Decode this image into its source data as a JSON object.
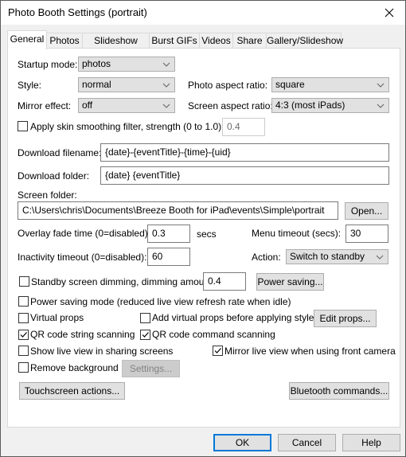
{
  "window": {
    "title": "Photo Booth Settings (portrait)",
    "close_icon": "close-icon"
  },
  "tabs": [
    {
      "label": "General",
      "active": true
    },
    {
      "label": "Photos",
      "active": false
    },
    {
      "label": "Slideshow GIFs",
      "active": false
    },
    {
      "label": "Burst GIFs",
      "active": false
    },
    {
      "label": "Videos",
      "active": false
    },
    {
      "label": "Share",
      "active": false
    },
    {
      "label": "Gallery/Slideshow",
      "active": false
    }
  ],
  "general": {
    "startup_mode": {
      "label": "Startup mode:",
      "value": "photos"
    },
    "style": {
      "label": "Style:",
      "value": "normal"
    },
    "mirror_effect": {
      "label": "Mirror effect:",
      "value": "off"
    },
    "photo_aspect_ratio": {
      "label": "Photo aspect ratio:",
      "value": "square"
    },
    "screen_aspect_ratio": {
      "label": "Screen aspect ratio:",
      "value": "4:3 (most iPads)"
    },
    "skin_smoothing": {
      "label": "Apply skin smoothing filter, strength (0 to 1.0):",
      "checked": false,
      "value": "0.4"
    },
    "download_filename": {
      "label": "Download filename:",
      "value": "{date}-{eventTitle}-{time}-{uid}"
    },
    "download_folder": {
      "label": "Download folder:",
      "value": "{date} {eventTitle}"
    },
    "screen_folder": {
      "label": "Screen folder:",
      "value": "C:\\Users\\chris\\Documents\\Breeze Booth for iPad\\events\\Simple\\portrait",
      "open_button": "Open..."
    },
    "overlay_fade": {
      "label": "Overlay fade time (0=disabled):",
      "value": "0.3",
      "unit": "secs"
    },
    "menu_timeout": {
      "label": "Menu timeout (secs):",
      "value": "30"
    },
    "inactivity_timeout": {
      "label": "Inactivity timeout (0=disabled):",
      "value": "60"
    },
    "action": {
      "label": "Action:",
      "value": "Switch to standby"
    },
    "standby_dimming": {
      "label": "Standby screen dimming, dimming amount:",
      "checked": false,
      "value": "0.4",
      "button": "Power saving..."
    },
    "power_saving_mode": {
      "label": "Power saving mode (reduced live view refresh rate when idle)",
      "checked": false
    },
    "virtual_props": {
      "label": "Virtual props",
      "checked": false
    },
    "add_virtual_props": {
      "label": "Add virtual props before applying styles",
      "checked": false,
      "button": "Edit props..."
    },
    "qr_string": {
      "label": "QR code string scanning",
      "checked": true
    },
    "qr_command": {
      "label": "QR code command scanning",
      "checked": true
    },
    "show_live_view": {
      "label": "Show live view in sharing screens",
      "checked": false
    },
    "mirror_live_view": {
      "label": "Mirror live view when using front camera",
      "checked": true
    },
    "remove_background": {
      "label": "Remove background",
      "checked": false,
      "button": "Settings..."
    },
    "touchscreen_button": "Touchscreen actions...",
    "bluetooth_button": "Bluetooth commands..."
  },
  "footer": {
    "ok": "OK",
    "cancel": "Cancel",
    "help": "Help"
  },
  "colors": {
    "accent": "#0078d7",
    "button_bg": "#e1e1e1",
    "dialog_bg": "#f0f0f0"
  }
}
